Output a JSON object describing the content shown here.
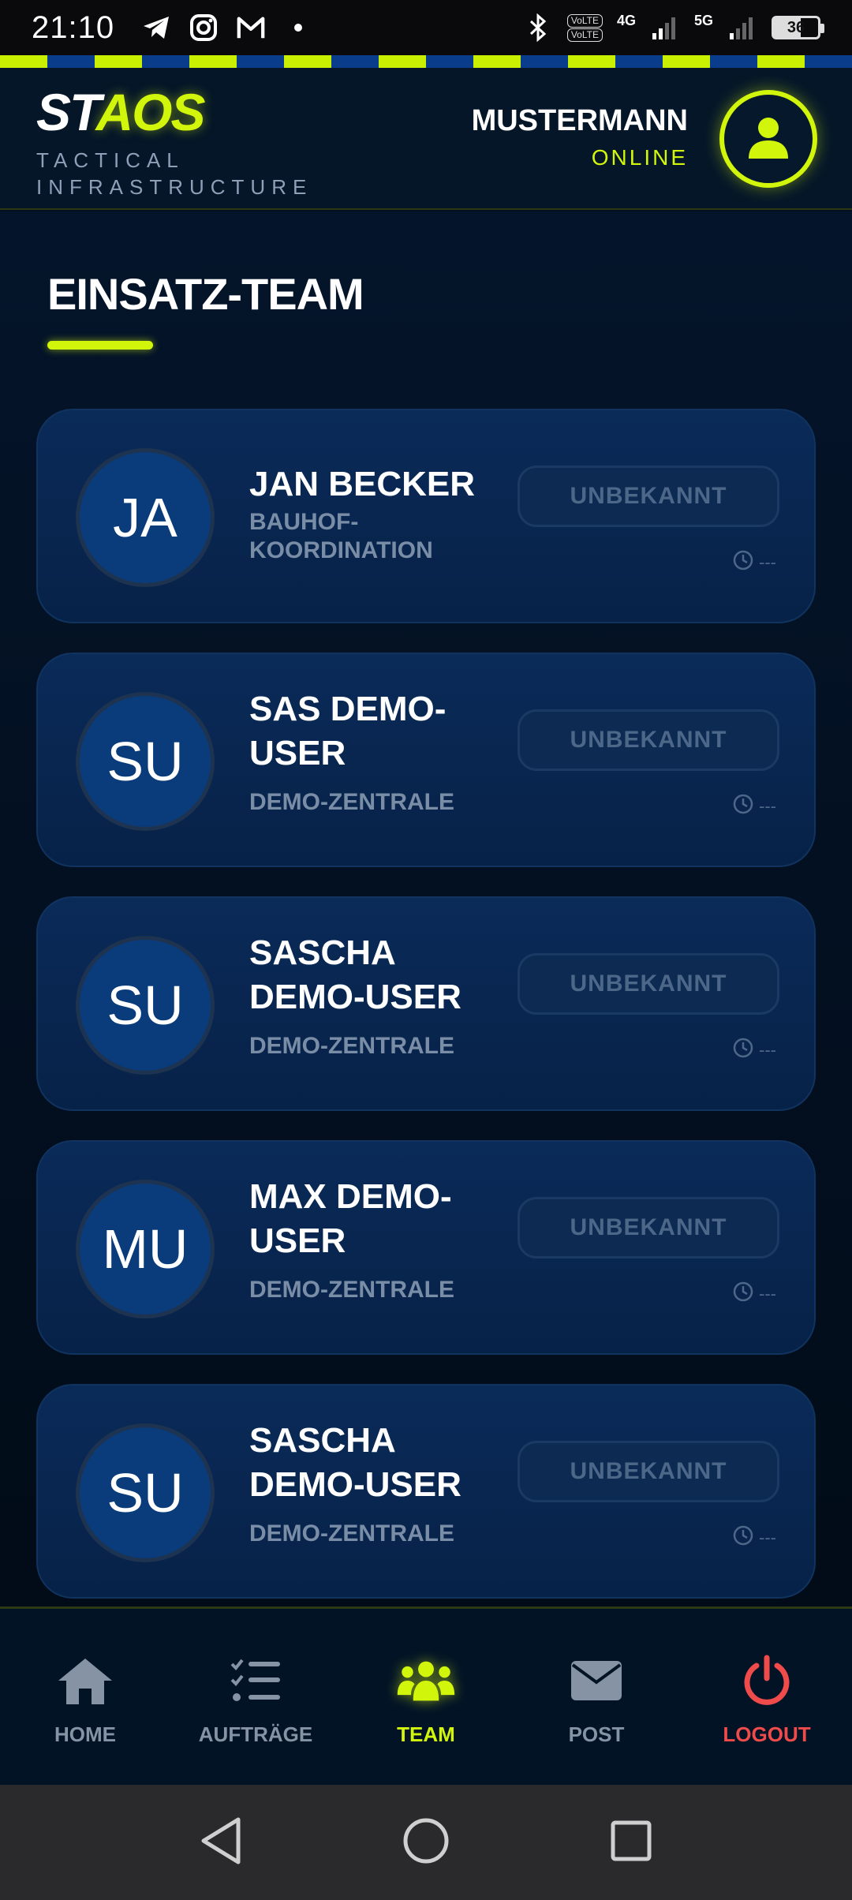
{
  "status_bar": {
    "time": "21:10",
    "battery": "36",
    "network_labels": [
      "4G",
      "5G"
    ],
    "volte_labels": [
      "VoLTE",
      "VoLTE"
    ]
  },
  "header": {
    "logo_part1": "ST",
    "logo_part2": "AOS",
    "tagline_line1": "TACTICAL",
    "tagline_line2": "INFRASTRUCTURE",
    "user_name": "MUSTERMANN",
    "user_status": "ONLINE",
    "avatar_icon": "user-icon"
  },
  "page": {
    "title": "EINSATZ-TEAM"
  },
  "members": [
    {
      "initials": "JA",
      "name": "JAN BECKER",
      "role": "BAUHOF-KOORDINATION",
      "status": "UNBEKANNT",
      "last_seen": "---"
    },
    {
      "initials": "SU",
      "name": "SAS DEMO-USER",
      "role": "DEMO-ZENTRALE",
      "status": "UNBEKANNT",
      "last_seen": "---"
    },
    {
      "initials": "SU",
      "name": "SASCHA DEMO-USER",
      "role": "DEMO-ZENTRALE",
      "status": "UNBEKANNT",
      "last_seen": "---"
    },
    {
      "initials": "MU",
      "name": "MAX DEMO-USER",
      "role": "DEMO-ZENTRALE",
      "status": "UNBEKANNT",
      "last_seen": "---"
    },
    {
      "initials": "SU",
      "name": "SASCHA DEMO-USER",
      "role": "DEMO-ZENTRALE",
      "status": "UNBEKANNT",
      "last_seen": "---"
    }
  ],
  "nav": {
    "home": "HOME",
    "tasks": "AUFTRÄGE",
    "team": "TEAM",
    "post": "POST",
    "logout": "LOGOUT"
  },
  "colors": {
    "accent": "#d2f50c",
    "logout": "#ef4b4b",
    "background": "#04101f",
    "card": "#0a2a58"
  }
}
